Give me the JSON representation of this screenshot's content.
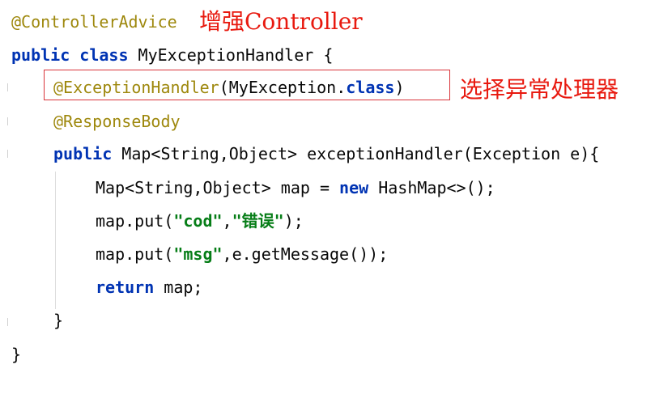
{
  "code": {
    "l1_annotation": "@ControllerAdvice",
    "l2_kw_public": "public",
    "l2_kw_class": "class",
    "l2_rest": " MyExceptionHandler {",
    "l3_annotation": "@ExceptionHandler",
    "l3_paren_open": "(MyException",
    "l3_dot": ".",
    "l3_kw_class": "class",
    "l3_paren_close": ")",
    "l4_annotation": "@ResponseBody",
    "l5_kw_public": "public",
    "l5_rest": " Map<String,Object> exceptionHandler(Exception e){",
    "l6_before": "Map<String,Object> map = ",
    "l6_kw_new": "new",
    "l6_after": " HashMap<>();",
    "l7_call": "map.put(",
    "l7_str1": "\"cod\"",
    "l7_comma": ",",
    "l7_str2": "\"错误\"",
    "l7_end": ");",
    "l8_call": "map.put(",
    "l8_str1": "\"msg\"",
    "l8_rest": ",e.getMessage());",
    "l9_kw_return": "return",
    "l9_rest": " map;",
    "l10_brace": "}",
    "l11_brace": "}"
  },
  "notes": {
    "controller_note": "增强Controller",
    "handler_note": "选择异常处理器"
  },
  "colors": {
    "annotation": "#9e880d",
    "keyword": "#0033b3",
    "string": "#067d17",
    "note_red": "#e8190f",
    "box_red": "#d9343a"
  }
}
